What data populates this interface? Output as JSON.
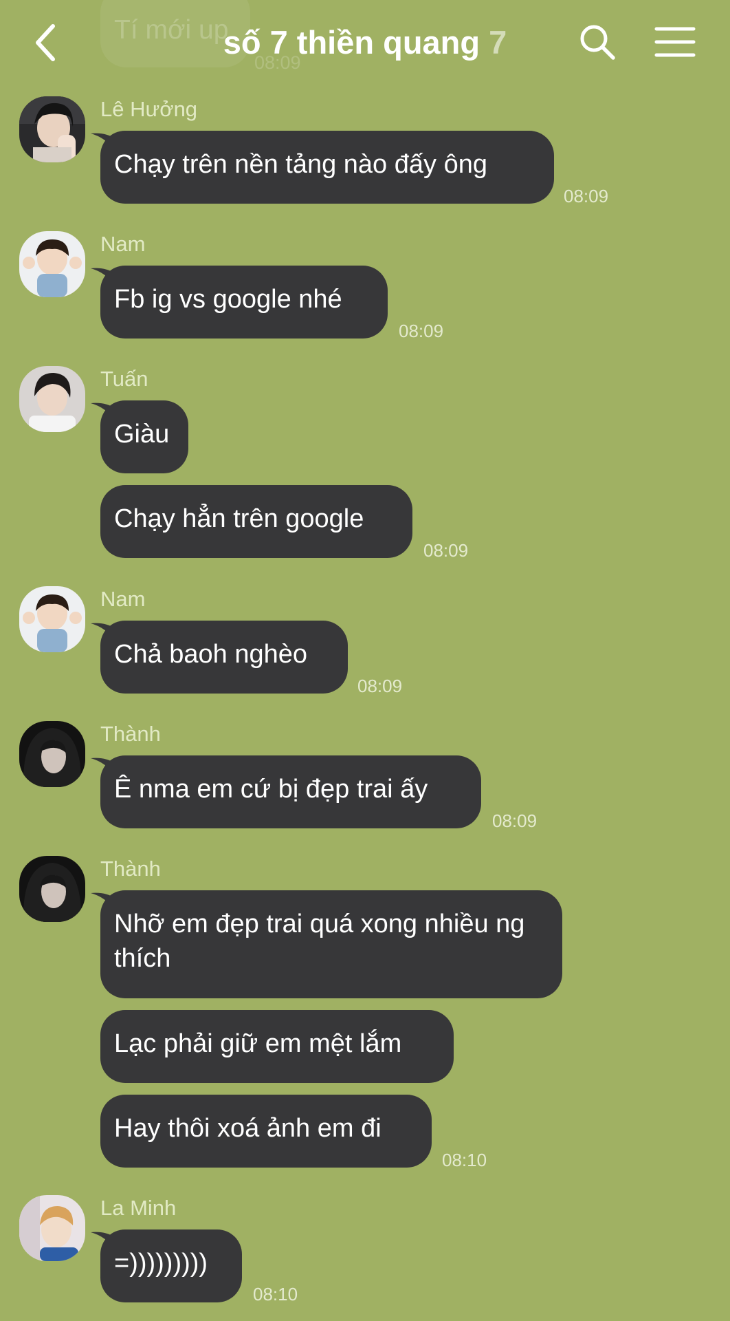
{
  "header": {
    "title": "số 7 thiền quang",
    "count": "7",
    "back_icon": "chevron-left-icon",
    "search_icon": "search-icon",
    "menu_icon": "hamburger-menu-icon"
  },
  "faded_message": {
    "text": "Tí mới up",
    "time": "08:09"
  },
  "messages": [
    {
      "sender": "Lê Hưởng",
      "bubbles": [
        "Chạy trên nền tảng nào đấy ông"
      ],
      "time": "08:09"
    },
    {
      "sender": "Nam",
      "bubbles": [
        "Fb ig vs google nhé"
      ],
      "time": "08:09"
    },
    {
      "sender": "Tuấn",
      "bubbles": [
        "Giàu",
        "Chạy hẳn trên google"
      ],
      "time": "08:09"
    },
    {
      "sender": "Nam",
      "bubbles": [
        "Chả baoh nghèo"
      ],
      "time": "08:09"
    },
    {
      "sender": "Thành",
      "bubbles": [
        "Ê nma em cứ bị đẹp trai ấy"
      ],
      "time": "08:09"
    },
    {
      "sender": "Thành",
      "bubbles": [
        "Nhỡ em đẹp trai quá xong nhiều ng thích",
        "Lạc phải giữ em mệt lắm",
        "Hay thôi xoá ảnh em đi"
      ],
      "time": "08:10"
    },
    {
      "sender": "La Minh",
      "bubbles": [
        "=)))))))))"
      ],
      "time": "08:10"
    }
  ],
  "colors": {
    "background": "#A0B163",
    "bubble": "#373739",
    "bubble_text": "#FFFFFF",
    "sender_text": "#E2EAC5"
  }
}
